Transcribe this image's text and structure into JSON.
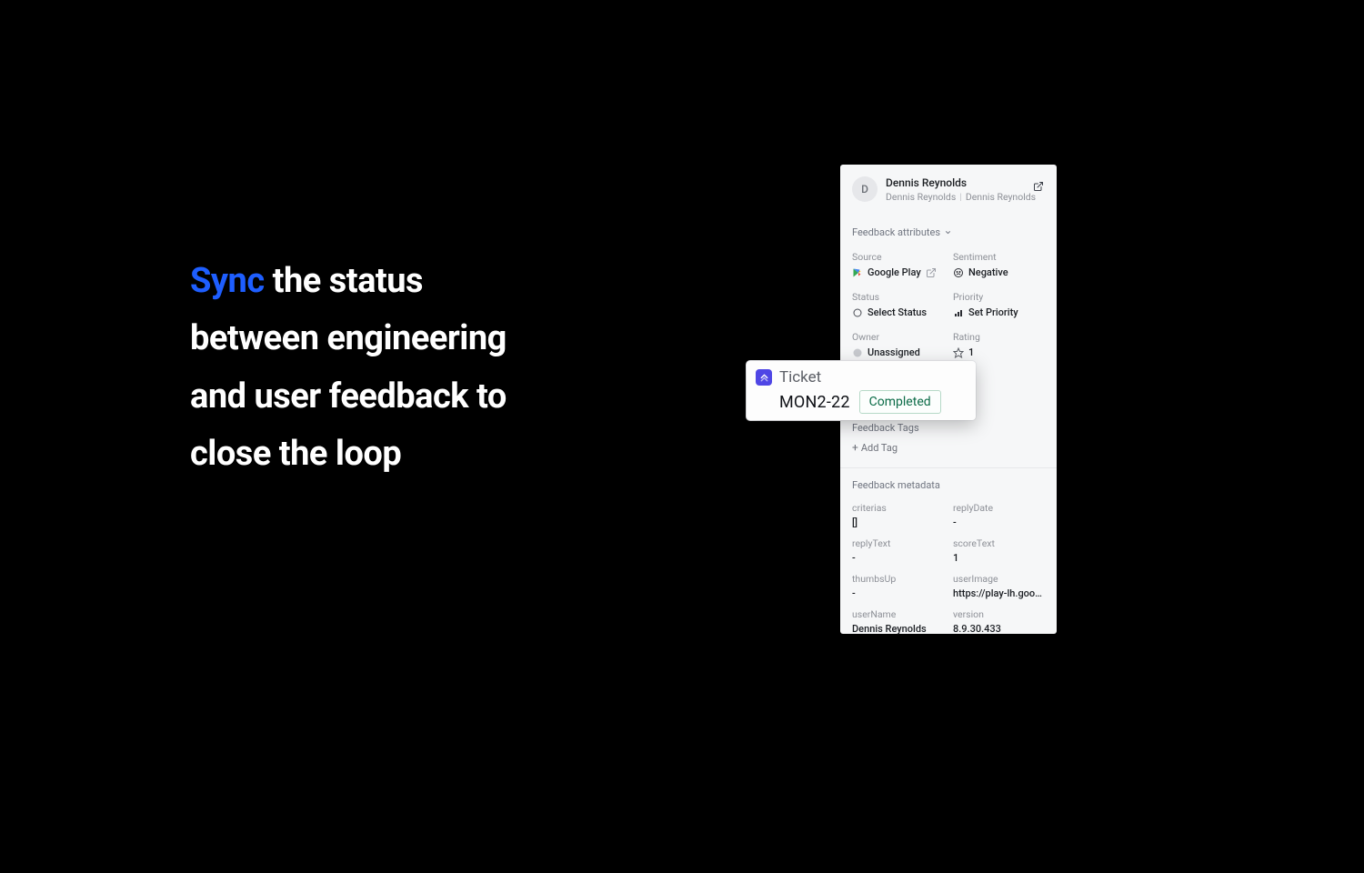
{
  "headline": {
    "accent": "Sync",
    "rest": " the status between engineering and user feedback to close the loop"
  },
  "card": {
    "user": {
      "initial": "D",
      "name": "Dennis Reynolds",
      "sub_a": "Dennis Reynolds",
      "sub_b": "Dennis Reynolds"
    },
    "sections": {
      "attributes_title": "Feedback attributes",
      "tags_title": "Feedback Tags",
      "addtag_label": "Add Tag",
      "metadata_title": "Feedback metadata"
    },
    "attributes": {
      "source": {
        "label": "Source",
        "value": "Google Play"
      },
      "sentiment": {
        "label": "Sentiment",
        "value": "Negative"
      },
      "status": {
        "label": "Status",
        "value": "Select Status"
      },
      "priority": {
        "label": "Priority",
        "value": "Set Priority"
      },
      "owner": {
        "label": "Owner",
        "value": "Unassigned"
      },
      "rating": {
        "label": "Rating",
        "value": "1"
      }
    },
    "metadata": {
      "criterias": {
        "label": "criterias",
        "value": "[]"
      },
      "replyDate": {
        "label": "replyDate",
        "value": "-"
      },
      "replyText": {
        "label": "replyText",
        "value": "-"
      },
      "scoreText": {
        "label": "scoreText",
        "value": "1"
      },
      "thumbsUp": {
        "label": "thumbsUp",
        "value": "-"
      },
      "userImage": {
        "label": "userImage",
        "value": "https://play-lh.goo…"
      },
      "userName": {
        "label": "userName",
        "value": "Dennis Reynolds"
      },
      "version": {
        "label": "version",
        "value": "8.9.30.433"
      }
    }
  },
  "ticket": {
    "title": "Ticket",
    "id": "MON2-22",
    "status": "Completed"
  }
}
